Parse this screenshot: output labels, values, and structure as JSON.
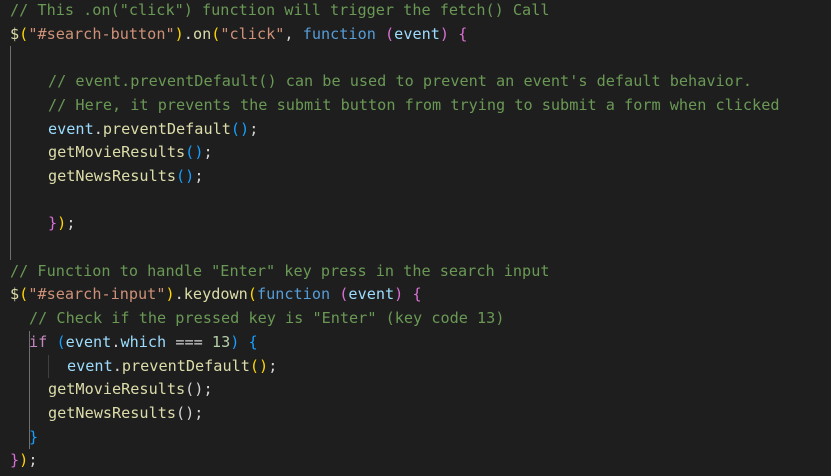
{
  "editor": {
    "language": "javascript",
    "lines": [
      {
        "indent": 0,
        "tokens": [
          {
            "t": "// This .on(\"click\") function will trigger the fetch() Call",
            "c": "comment"
          }
        ]
      },
      {
        "indent": 0,
        "tokens": [
          {
            "t": "$",
            "c": "func"
          },
          {
            "t": "(",
            "c": "brace1"
          },
          {
            "t": "\"#search-button\"",
            "c": "string"
          },
          {
            "t": ")",
            "c": "brace1"
          },
          {
            "t": ".",
            "c": "plain"
          },
          {
            "t": "on",
            "c": "func"
          },
          {
            "t": "(",
            "c": "brace1"
          },
          {
            "t": "\"click\"",
            "c": "string"
          },
          {
            "t": ", ",
            "c": "plain"
          },
          {
            "t": "function",
            "c": "keyword"
          },
          {
            "t": " ",
            "c": "plain"
          },
          {
            "t": "(",
            "c": "brace2"
          },
          {
            "t": "event",
            "c": "var"
          },
          {
            "t": ")",
            "c": "brace2"
          },
          {
            "t": " ",
            "c": "plain"
          },
          {
            "t": "{",
            "c": "brace2"
          }
        ]
      },
      {
        "indent": 0,
        "tokens": []
      },
      {
        "indent": 4,
        "tokens": [
          {
            "t": "// event.preventDefault() can be used to prevent an event's default behavior.",
            "c": "comment"
          }
        ]
      },
      {
        "indent": 4,
        "tokens": [
          {
            "t": "// Here, it prevents the submit button from trying to submit a form when clicked",
            "c": "comment"
          }
        ]
      },
      {
        "indent": 4,
        "tokens": [
          {
            "t": "event",
            "c": "var"
          },
          {
            "t": ".",
            "c": "plain"
          },
          {
            "t": "preventDefault",
            "c": "func"
          },
          {
            "t": "(",
            "c": "brace3"
          },
          {
            "t": ")",
            "c": "brace3"
          },
          {
            "t": ";",
            "c": "plain"
          }
        ]
      },
      {
        "indent": 4,
        "tokens": [
          {
            "t": "getMovieResults",
            "c": "func"
          },
          {
            "t": "(",
            "c": "brace3"
          },
          {
            "t": ")",
            "c": "brace3"
          },
          {
            "t": ";",
            "c": "plain"
          }
        ]
      },
      {
        "indent": 4,
        "tokens": [
          {
            "t": "getNewsResults",
            "c": "func"
          },
          {
            "t": "(",
            "c": "brace3"
          },
          {
            "t": ")",
            "c": "brace3"
          },
          {
            "t": ";",
            "c": "plain"
          }
        ]
      },
      {
        "indent": 0,
        "tokens": []
      },
      {
        "indent": 4,
        "tokens": [
          {
            "t": "}",
            "c": "brace2"
          },
          {
            "t": ")",
            "c": "brace1"
          },
          {
            "t": ";",
            "c": "plain"
          }
        ]
      },
      {
        "indent": 0,
        "tokens": []
      },
      {
        "indent": 0,
        "tokens": [
          {
            "t": "// Function to handle \"Enter\" key press in the search input",
            "c": "comment"
          }
        ]
      },
      {
        "indent": 0,
        "tokens": [
          {
            "t": "$",
            "c": "func"
          },
          {
            "t": "(",
            "c": "brace1"
          },
          {
            "t": "\"#search-input\"",
            "c": "string"
          },
          {
            "t": ")",
            "c": "brace1"
          },
          {
            "t": ".",
            "c": "plain"
          },
          {
            "t": "keydown",
            "c": "func"
          },
          {
            "t": "(",
            "c": "brace1"
          },
          {
            "t": "function",
            "c": "keyword"
          },
          {
            "t": " ",
            "c": "plain"
          },
          {
            "t": "(",
            "c": "brace2"
          },
          {
            "t": "event",
            "c": "var"
          },
          {
            "t": ")",
            "c": "brace2"
          },
          {
            "t": " ",
            "c": "plain"
          },
          {
            "t": "{",
            "c": "brace2"
          }
        ]
      },
      {
        "indent": 2,
        "tokens": [
          {
            "t": "// Check if the pressed key is \"Enter\" (key code 13)",
            "c": "comment"
          }
        ]
      },
      {
        "indent": 2,
        "tokens": [
          {
            "t": "if",
            "c": "control"
          },
          {
            "t": " ",
            "c": "plain"
          },
          {
            "t": "(",
            "c": "brace3"
          },
          {
            "t": "event",
            "c": "var"
          },
          {
            "t": ".",
            "c": "plain"
          },
          {
            "t": "which",
            "c": "var"
          },
          {
            "t": " === ",
            "c": "plain"
          },
          {
            "t": "13",
            "c": "number"
          },
          {
            "t": ")",
            "c": "brace3"
          },
          {
            "t": " ",
            "c": "plain"
          },
          {
            "t": "{",
            "c": "brace3"
          }
        ]
      },
      {
        "indent": 6,
        "tokens": [
          {
            "t": "event",
            "c": "var"
          },
          {
            "t": ".",
            "c": "plain"
          },
          {
            "t": "preventDefault",
            "c": "func"
          },
          {
            "t": "(",
            "c": "brace1"
          },
          {
            "t": ")",
            "c": "brace1"
          },
          {
            "t": ";",
            "c": "plain"
          }
        ]
      },
      {
        "indent": 4,
        "tokens": [
          {
            "t": "getMovieResults",
            "c": "func"
          },
          {
            "t": "();",
            "c": "plain"
          }
        ]
      },
      {
        "indent": 4,
        "tokens": [
          {
            "t": "getNewsResults",
            "c": "func"
          },
          {
            "t": "();",
            "c": "plain"
          }
        ]
      },
      {
        "indent": 2,
        "tokens": [
          {
            "t": "}",
            "c": "brace3"
          }
        ]
      },
      {
        "indent": 0,
        "tokens": [
          {
            "t": "}",
            "c": "brace2"
          },
          {
            "t": ")",
            "c": "brace1"
          },
          {
            "t": ";",
            "c": "plain"
          }
        ]
      }
    ]
  }
}
